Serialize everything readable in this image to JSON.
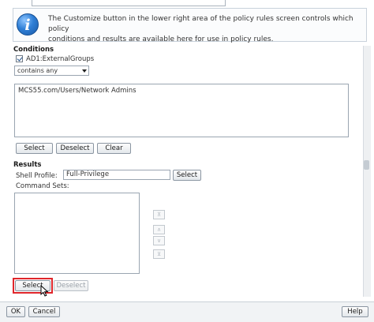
{
  "info": {
    "icon": "info-icon",
    "glyph": "i",
    "line1": "The Customize button in the lower right area of the policy rules screen controls which policy",
    "line2": "conditions and results are available here for use in policy rules."
  },
  "conditions": {
    "heading": "Conditions",
    "checkbox_label": "AD1:ExternalGroups",
    "checked": true,
    "operator": "contains any",
    "value": "MCS55.com/Users/Network Admins",
    "buttons": {
      "select": "Select",
      "deselect": "Deselect",
      "clear": "Clear"
    }
  },
  "results": {
    "heading": "Results",
    "shell_profile_label": "Shell Profile:",
    "shell_profile_value": "Full-Privilege",
    "shell_select": "Select",
    "command_sets_label": "Command Sets:",
    "command_sets": [],
    "order_buttons": {
      "top": "⊼",
      "up": "∧",
      "down": "∨",
      "bottom": "⊻"
    },
    "select": "Select",
    "deselect": "Deselect"
  },
  "footer": {
    "ok": "OK",
    "cancel": "Cancel",
    "help": "Help"
  },
  "colors": {
    "highlight": "#e0262b",
    "info_icon": "#2f7fd6"
  }
}
